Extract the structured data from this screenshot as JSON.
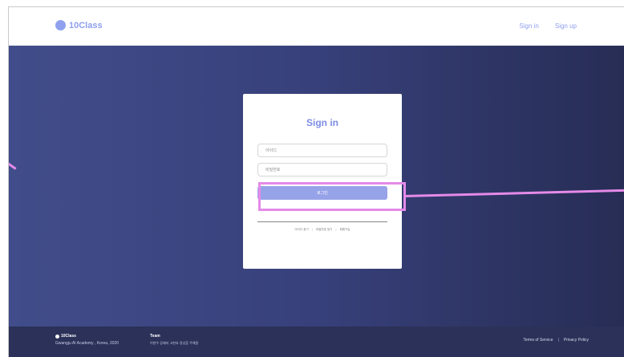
{
  "header": {
    "brand": "10Class",
    "nav": {
      "sign_in": "Sign in",
      "sign_up": "Sign up"
    }
  },
  "login": {
    "title": "Sign in",
    "id_placeholder": "아이디",
    "pw_placeholder": "비밀번호",
    "submit_label": "로그인",
    "links": [
      "아이디 찾기",
      "비밀번호 찾기",
      "회원가입"
    ],
    "separator": "|"
  },
  "footer": {
    "brand": "10Class",
    "subtitle": "Gwangju AI Academy , Korea, 2020",
    "team_title": "Team",
    "team_members": "이현우  강혜지  고현호  정성훈  주해원",
    "terms": "Terms of Service",
    "privacy": "Privacy Policy",
    "separator": "|"
  },
  "colors": {
    "accent": "#8fa0ee",
    "button": "#97a3e8",
    "hero_dark": "#272d55",
    "annotation": "#e58ae8"
  }
}
